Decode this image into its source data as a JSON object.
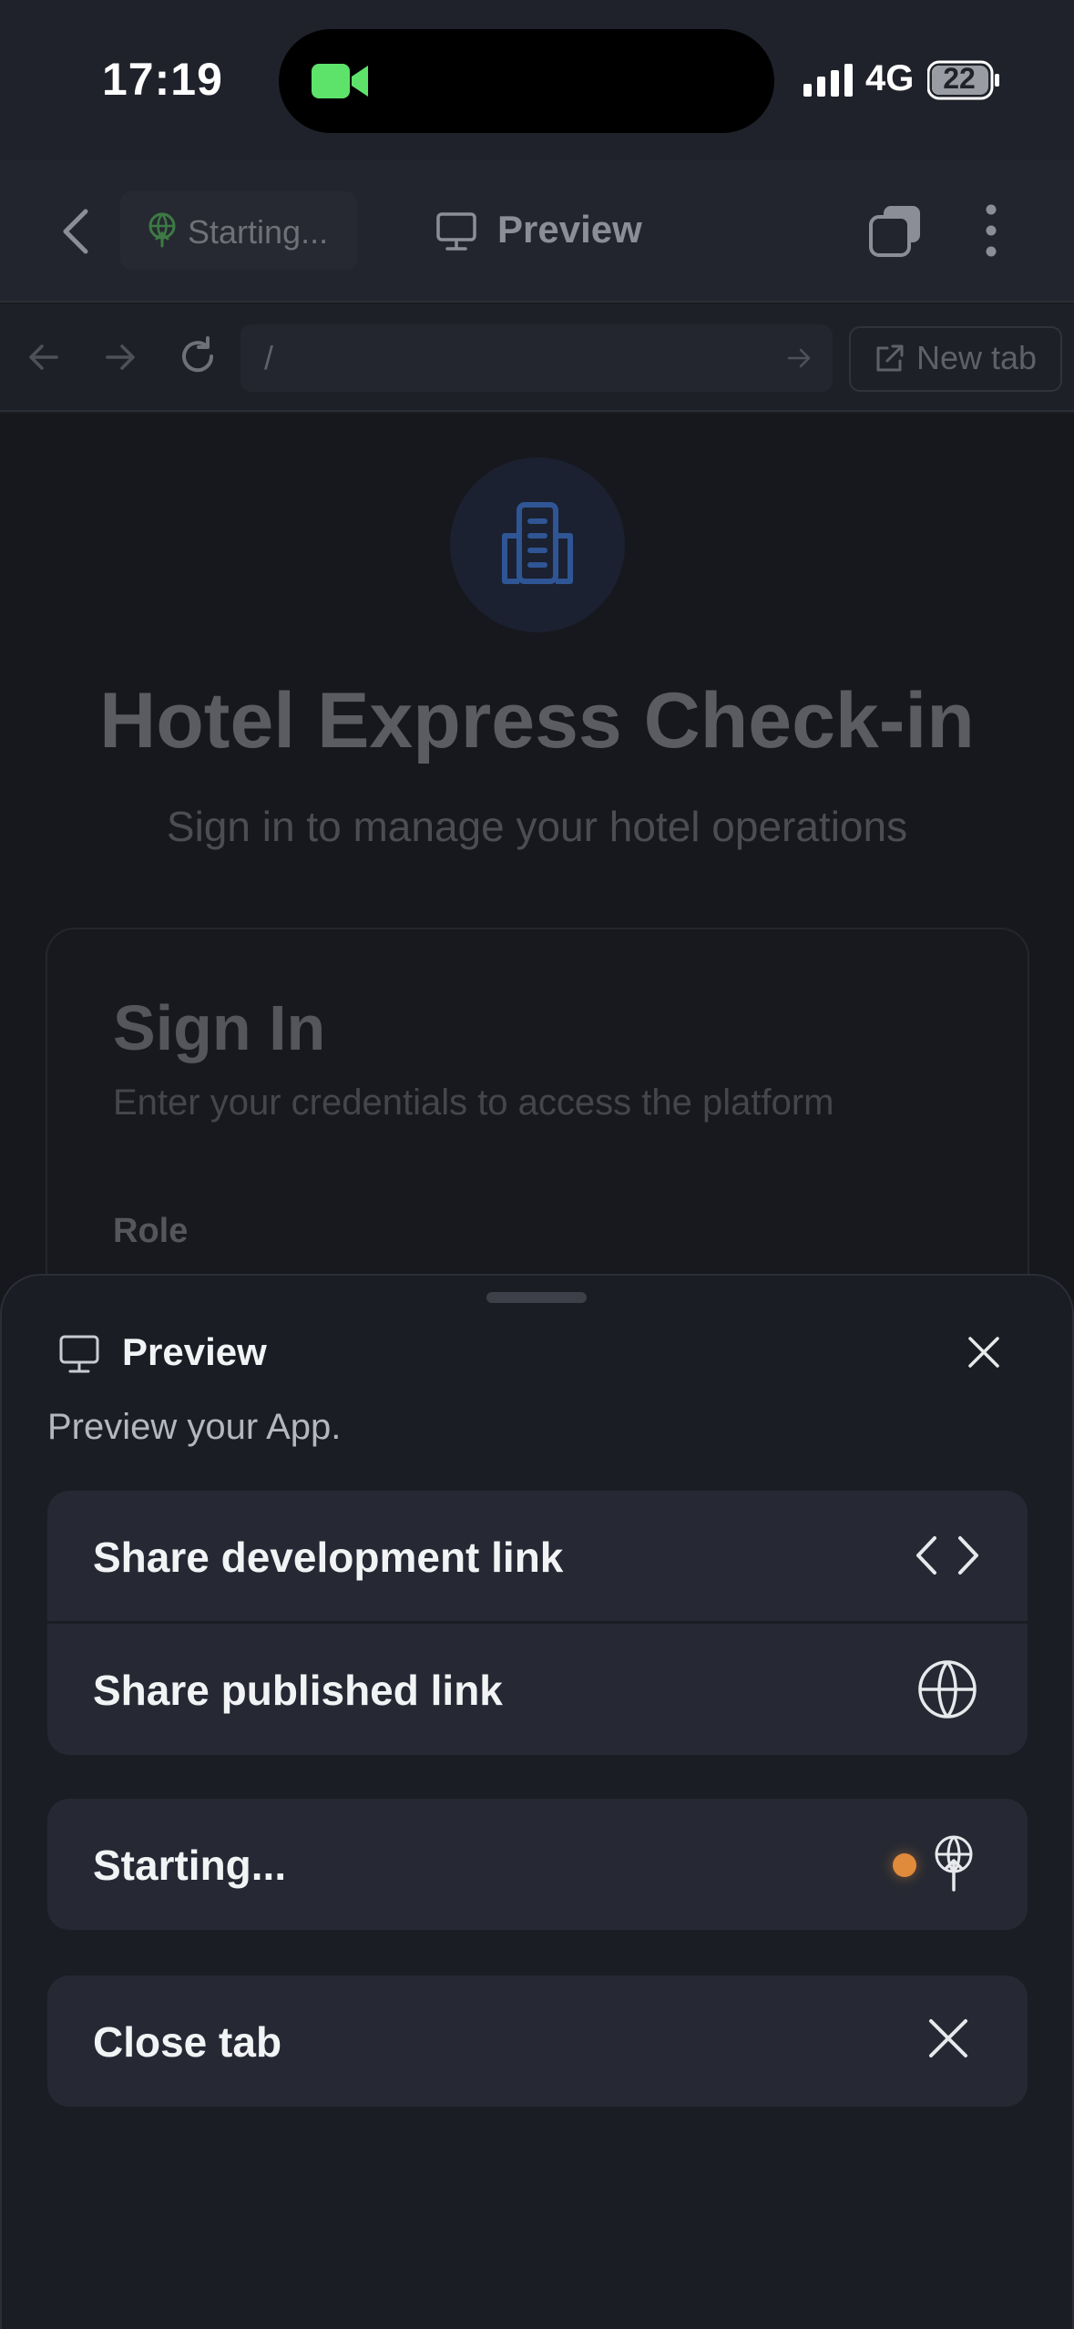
{
  "status_bar": {
    "time": "17:19",
    "network": "4G",
    "battery": "22",
    "icons": [
      "facetime-camera-icon",
      "cellular-signal-icon",
      "battery-icon"
    ]
  },
  "top_bar": {
    "status_pill": "Starting...",
    "title": "Preview",
    "icons": [
      "back-chevron-icon",
      "deploy-icon",
      "monitor-icon",
      "tabs-icon",
      "more-vertical-icon"
    ]
  },
  "url_bar": {
    "path": "/",
    "new_tab_label": "New tab",
    "icons": [
      "arrow-left-icon",
      "arrow-right-icon",
      "reload-icon",
      "go-arrow-icon",
      "external-link-icon"
    ]
  },
  "page": {
    "logo_icon": "building-icon",
    "title": "Hotel Express Check-in",
    "subtitle": "Sign in to manage your hotel operations",
    "card": {
      "title": "Sign In",
      "subtitle": "Enter your credentials to access the platform",
      "role_label": "Role"
    }
  },
  "sheet": {
    "title": "Preview",
    "description": "Preview your App.",
    "items": {
      "dev_link": "Share development link",
      "published_link": "Share published link",
      "status": "Starting...",
      "close_tab": "Close tab"
    },
    "colors": {
      "status_dot": "#e08a3b",
      "accent_blue": "#3b6fd8"
    }
  }
}
